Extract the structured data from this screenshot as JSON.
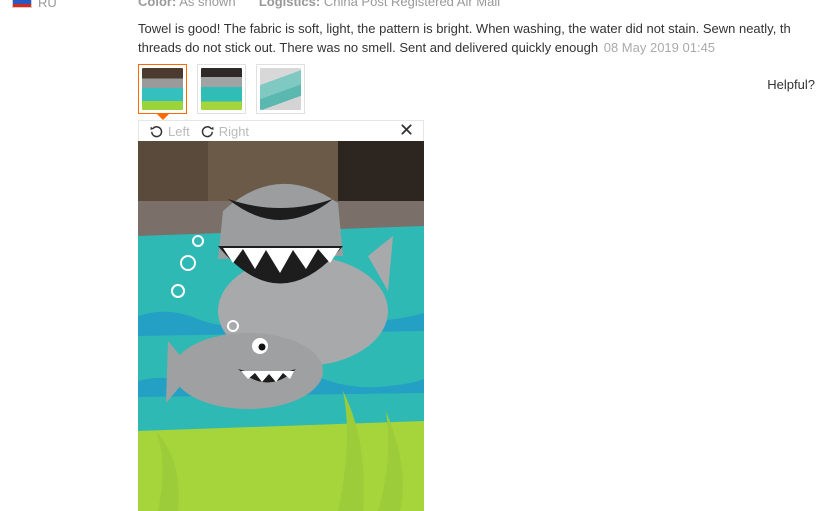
{
  "reviewer": {
    "country": "RU"
  },
  "meta": {
    "color_key": "Color:",
    "color_value": "As shown",
    "logistics_key": "Logistics:",
    "logistics_value": "China Post Registered Air Mail"
  },
  "review": {
    "line1": "Towel is good! The fabric is soft, light, the pattern is bright. When washing, the water did not stain. Sewn neatly, th",
    "line2": "threads do not stick out. There was no smell. Sent and delivered quickly enough",
    "date": "08 May 2019 01:45"
  },
  "helpful_label": "Helpful?",
  "viewer": {
    "rotate_left_label": "Left",
    "rotate_right_label": "Right"
  },
  "thumbnails": [
    {
      "active": true
    },
    {
      "active": false
    },
    {
      "active": false
    }
  ],
  "icons": {
    "rotate_left": "rotate-left-icon",
    "rotate_right": "rotate-right-icon",
    "close": "close-icon",
    "flag": "russia-flag-icon"
  },
  "colors": {
    "accent": "#ff6a00",
    "muted_text": "#999999",
    "body_text": "#333333"
  }
}
